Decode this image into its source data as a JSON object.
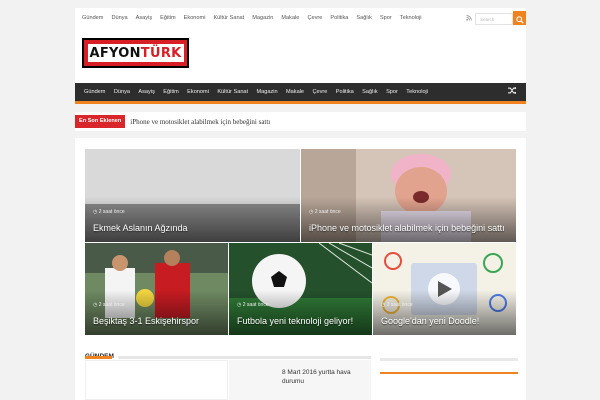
{
  "top_nav": {
    "items": [
      "Gündem",
      "Dünya",
      "Asayiş",
      "Eğitim",
      "Ekonomi",
      "Kültür Sanat",
      "Magazin",
      "Makale",
      "Çevre",
      "Politika",
      "Sağlık",
      "Spor",
      "Teknoloji"
    ],
    "search_placeholder": "Search"
  },
  "logo": {
    "part1": "AFYON",
    "part2": "TÜRK"
  },
  "main_nav": {
    "items": [
      "Gündem",
      "Dünya",
      "Asayiş",
      "Eğitim",
      "Ekonomi",
      "Kültür Sanat",
      "Magazin",
      "Makale",
      "Çevre",
      "Politika",
      "Sağlık",
      "Spor",
      "Teknoloji"
    ]
  },
  "ticker": {
    "label": "En Son Eklenen",
    "text": "iPhone ve motosiklet alabilmek için bebeğini sattı"
  },
  "featured": [
    {
      "time": "2 saat önce",
      "title": "Ekmek Aslanın Ağzında"
    },
    {
      "time": "2 saat önce",
      "title": "iPhone ve motosiklet alabilmek için bebeğini sattı"
    },
    {
      "time": "2 saat önce",
      "title": "Beşiktaş 3-1 Eskişehirspor"
    },
    {
      "time": "2 saat önce",
      "title": "Futbola yeni teknoloji geliyor!"
    },
    {
      "time": "2 saat önce",
      "title": "Google'dan yeni Doodle!"
    }
  ],
  "section": {
    "title": "Gündem",
    "news_title": "8 Mart 2016 yurtta hava durumu"
  },
  "colors": {
    "accent": "#f0831f",
    "nav_bg": "#2d2d2d",
    "ticker_label": "#d8262b",
    "logo_red": "#d81f26"
  }
}
